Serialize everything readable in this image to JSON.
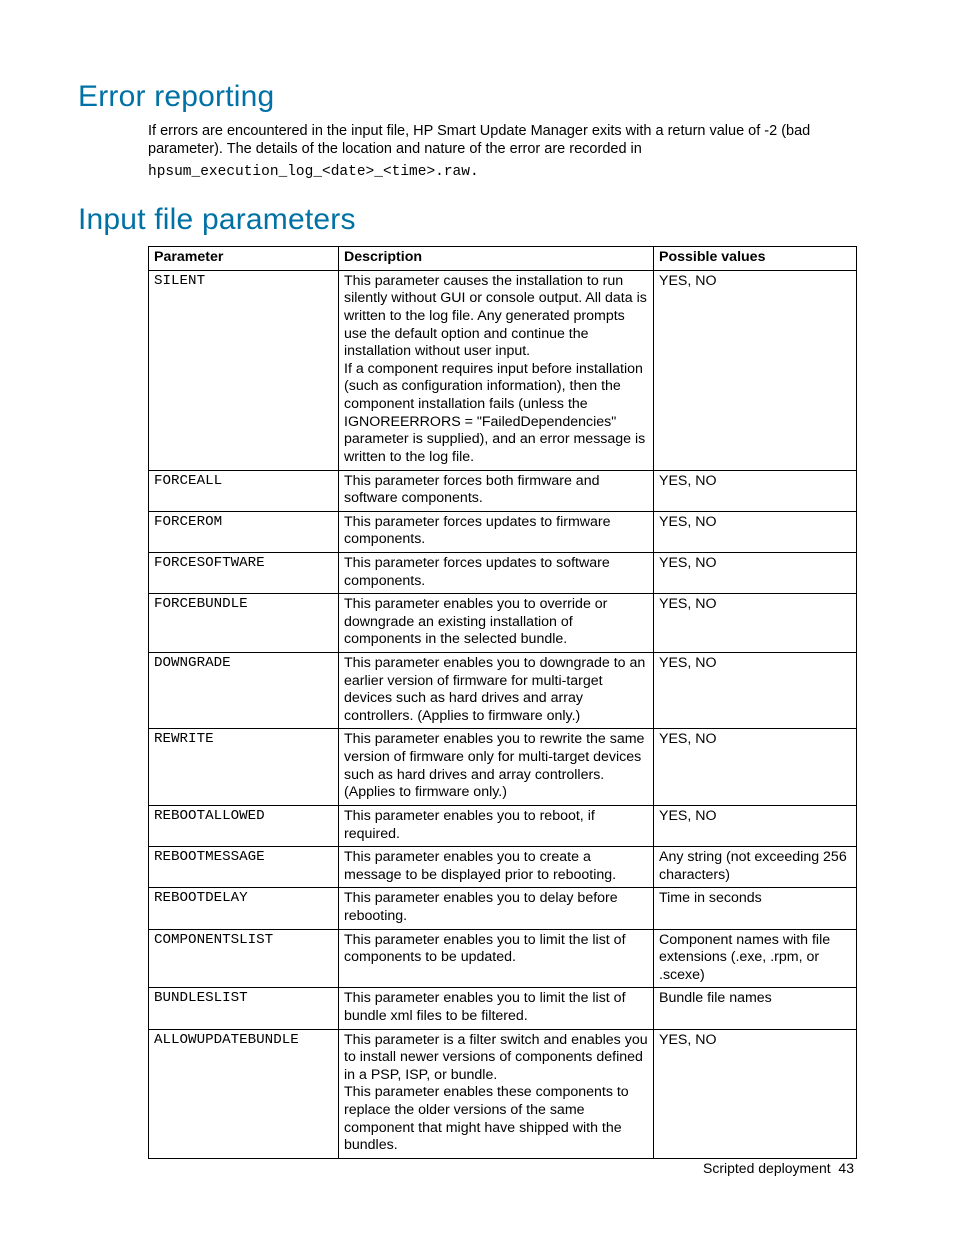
{
  "sections": {
    "error_reporting": {
      "title": "Error reporting",
      "paragraph": "If errors are encountered in the input file, HP Smart Update Manager exits with a return value of -2 (bad parameter). The details of the location and nature of the error are recorded in",
      "code_line": "hpsum_execution_log_<date>_<time>.raw."
    },
    "input_file_parameters": {
      "title": "Input file parameters"
    }
  },
  "table": {
    "headers": {
      "parameter": "Parameter",
      "description": "Description",
      "possible_values": "Possible values"
    },
    "rows": [
      {
        "param": "SILENT",
        "desc_parts": [
          "This parameter causes the installation to run silently without GUI or console output. All data is written to the log file. Any generated prompts use the default option and continue the installation without user input.",
          "If a component requires input before installation (such as configuration information), then the component installation fails (unless the IGNOREERRORS = \"FailedDependencies\" parameter is supplied), and an error message is written to the log file."
        ],
        "values": "YES, NO"
      },
      {
        "param": "FORCEALL",
        "desc_parts": [
          "This parameter forces both firmware and software components."
        ],
        "values": "YES, NO"
      },
      {
        "param": "FORCEROM",
        "desc_parts": [
          "This parameter forces updates to firmware components."
        ],
        "values": "YES, NO"
      },
      {
        "param": "FORCESOFTWARE",
        "desc_parts": [
          "This parameter forces updates to software components."
        ],
        "values": "YES, NO"
      },
      {
        "param": "FORCEBUNDLE",
        "desc_parts": [
          "This parameter enables you to override or downgrade an existing installation of components in the selected bundle."
        ],
        "values": "YES, NO"
      },
      {
        "param": "DOWNGRADE",
        "desc_parts": [
          "This parameter enables you to downgrade to an earlier version of firmware for multi-target devices such as hard drives and array controllers. (Applies to firmware only.)"
        ],
        "values": "YES, NO"
      },
      {
        "param": "REWRITE",
        "desc_parts": [
          "This parameter enables you to rewrite the same version of firmware only for multi-target devices such as hard drives and array controllers. (Applies to firmware only.)"
        ],
        "values": "YES, NO"
      },
      {
        "param": "REBOOTALLOWED",
        "desc_parts": [
          "This parameter enables you to reboot, if required."
        ],
        "values": "YES, NO"
      },
      {
        "param": "REBOOTMESSAGE",
        "desc_parts": [
          "This parameter enables you to create a message to be displayed prior to rebooting."
        ],
        "values": "Any string (not exceeding 256 characters)"
      },
      {
        "param": "REBOOTDELAY",
        "desc_parts": [
          "This parameter enables you to delay before rebooting."
        ],
        "values": "Time in seconds"
      },
      {
        "param": "COMPONENTSLIST",
        "desc_parts": [
          "This parameter enables you to limit the list of components to be updated."
        ],
        "values": "Component names with file extensions (.exe, .rpm, or .scexe)"
      },
      {
        "param": "BUNDLESLIST",
        "desc_parts": [
          "This parameter enables you to limit the list of bundle xml files to be filtered."
        ],
        "values": "Bundle file names"
      },
      {
        "param": "ALLOWUPDATEBUNDLE",
        "desc_parts": [
          "This parameter is a filter switch and enables you to install newer versions of components defined in a PSP, ISP, or bundle.",
          "This parameter enables these components to replace the older versions of the same component that might have shipped with the bundles."
        ],
        "values": "YES, NO"
      }
    ]
  },
  "footer": {
    "text": "Scripted deployment",
    "page": "43"
  }
}
